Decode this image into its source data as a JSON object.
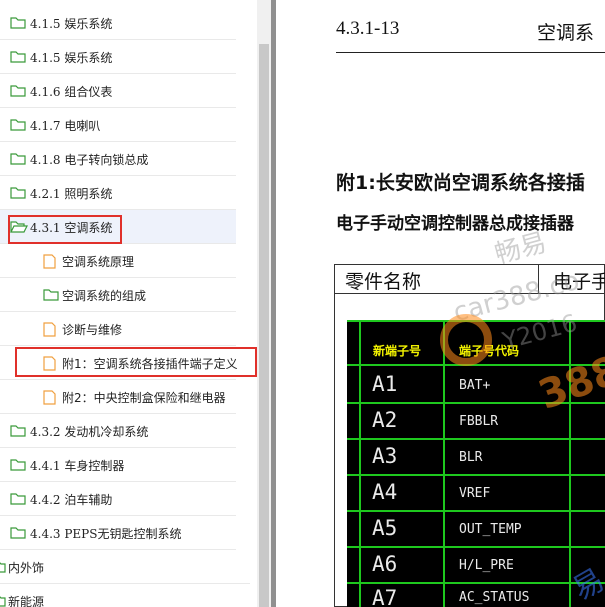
{
  "tree": {
    "items": [
      {
        "label": "4.1.5 娱乐系统"
      },
      {
        "label": "4.1.5 娱乐系统"
      },
      {
        "label": "4.1.6 组合仪表"
      },
      {
        "label": "4.1.7 电喇叭"
      },
      {
        "label": "4.1.8 电子转向锁总成"
      },
      {
        "label": "4.2.1 照明系统"
      },
      {
        "label": "4.3.1 空调系统"
      },
      {
        "label": "空调系统原理"
      },
      {
        "label": "空调系统的组成"
      },
      {
        "label": "诊断与维修"
      },
      {
        "label": "附1：空调系统各接插件端子定义"
      },
      {
        "label": "附2：中央控制盒保险和继电器"
      },
      {
        "label": "4.3.2 发动机冷却系统"
      },
      {
        "label": "4.4.1 车身控制器"
      },
      {
        "label": "4.4.2 泊车辅助"
      },
      {
        "label": "4.4.3 PEPS无钥匙控制系统"
      },
      {
        "label": "内外饰"
      },
      {
        "label": "新能源"
      }
    ]
  },
  "document": {
    "page_number": "4.3.1-13",
    "page_title": "空调系",
    "heading1": "附1:长安欧尚空调系统各接插",
    "heading2": "电子手动空调控制器总成接插器",
    "part_label": "零件名称",
    "part_value": "电子手",
    "table": {
      "headers": [
        "新端子号",
        "端子号代码"
      ],
      "rows": [
        {
          "pin": "A1",
          "signal": "BAT+"
        },
        {
          "pin": "A2",
          "signal": "FBBLR"
        },
        {
          "pin": "A3",
          "signal": "BLR"
        },
        {
          "pin": "A4",
          "signal": "VREF"
        },
        {
          "pin": "A5",
          "signal": "OUT_TEMP"
        },
        {
          "pin": "A6",
          "signal": "H/L_PRE"
        },
        {
          "pin": "A7",
          "signal": "AC_STATUS"
        }
      ]
    },
    "watermarks": [
      "畅易",
      "car388.co",
      "Y2016",
      "388",
      "易"
    ]
  },
  "colors": {
    "highlight_box": "#e0302a",
    "selected_row": "#eef2fb",
    "cad_background": "#000000",
    "cad_grid": "#1ec81e",
    "cad_header_text": "#f2f200",
    "watermark_orange": "#ff8a1a"
  }
}
